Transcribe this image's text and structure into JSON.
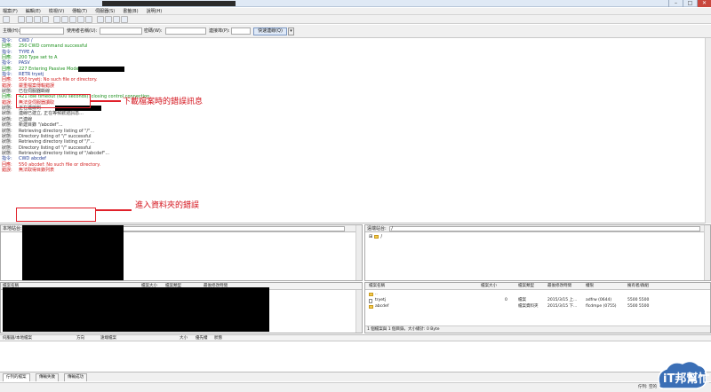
{
  "titlebar": {
    "controls": [
      "–",
      "□",
      "✕"
    ]
  },
  "menu": [
    "檔案(F)",
    "編輯(E)",
    "檢視(V)",
    "傳輸(T)",
    "伺服器(S)",
    "書籤(B)",
    "說明(H)"
  ],
  "quickconnect": {
    "host_label": "主機(H):",
    "user_label": "使用者名稱(U):",
    "pass_label": "密碼(W):",
    "port_label": "連接埠(P):",
    "button": "快速連線(Q)",
    "dropdown": "▾"
  },
  "log": [
    {
      "label": "指令:",
      "msg": "CWD /",
      "color": "blue"
    },
    {
      "label": "回應:",
      "msg": "250 CWD command successful",
      "color": "green"
    },
    {
      "label": "指令:",
      "msg": "TYPE A",
      "color": "blue"
    },
    {
      "label": "回應:",
      "msg": "200 Type set to A",
      "color": "green"
    },
    {
      "label": "指令:",
      "msg": "PASV",
      "color": "blue"
    },
    {
      "label": "回應:",
      "msg": "227 Entering Passive Mode",
      "color": "green",
      "redact": true
    },
    {
      "label": "指令:",
      "msg": "RETR tryetj",
      "color": "blue"
    },
    {
      "label": "回應:",
      "msg": "550 tryetj: No such file or directory.",
      "color": "red"
    },
    {
      "label": "錯誤:",
      "msg": "嚴重檔案傳輸錯誤",
      "color": "red"
    },
    {
      "label": "狀態:",
      "msg": "已在伺服器斷線",
      "color": "dark"
    },
    {
      "label": "回應:",
      "msg": "421 Idle timeout (600 seconds): closing control connection",
      "color": "green"
    },
    {
      "label": "錯誤:",
      "msg": "無法從伺服器讀取",
      "color": "red"
    },
    {
      "label": "狀態:",
      "msg": "正在連線到",
      "color": "dark",
      "redact": true
    },
    {
      "label": "狀態:",
      "msg": "連線已建立, 正在等候歡迎訊息...",
      "color": "dark"
    },
    {
      "label": "狀態:",
      "msg": "已連線",
      "color": "dark"
    },
    {
      "label": "狀態:",
      "msg": "新建目錄 \"/abcdef\"...",
      "color": "dark"
    },
    {
      "label": "狀態:",
      "msg": "Retrieving directory listing of \"/\"...",
      "color": "dark"
    },
    {
      "label": "狀態:",
      "msg": "Directory listing of \"/\" successful",
      "color": "dark"
    },
    {
      "label": "狀態:",
      "msg": "Retrieving directory listing of \"/\"...",
      "color": "dark"
    },
    {
      "label": "狀態:",
      "msg": "Directory listing of \"/\" successful",
      "color": "dark"
    },
    {
      "label": "狀態:",
      "msg": "Retrieving directory listing of \"/abcdef\"...",
      "color": "dark"
    },
    {
      "label": "指令:",
      "msg": "CWD abcdef",
      "color": "blue"
    },
    {
      "label": "回應:",
      "msg": "550 abcdef: No such file or directory.",
      "color": "red"
    },
    {
      "label": "錯誤:",
      "msg": "無法取得目錄列表",
      "color": "red"
    }
  ],
  "annotations": {
    "download_error": "下載檔案時的錯誤訊息",
    "enter_folder_error": "進入資料夾的錯誤"
  },
  "local": {
    "path_label": "本地站台:",
    "columns": [
      "檔案名稱",
      "檔案大小",
      "檔案類型",
      "最後修改時間"
    ]
  },
  "remote": {
    "path_label": "遠端站台:",
    "path_value": "/",
    "tree_root": "/",
    "columns": [
      "檔案名稱",
      "檔案大小",
      "檔案類型",
      "最後修改時間",
      "權限",
      "擁有者/群組"
    ],
    "files": [
      {
        "name": "..",
        "size": "",
        "type": "",
        "modified": "",
        "perm": "",
        "owner": "",
        "kind": "folder"
      },
      {
        "name": "tryetj",
        "size": "0",
        "type": "檔案",
        "modified": "2015/3/15 上...",
        "perm": "adfrw (0644)",
        "owner": "5500 5500",
        "kind": "file"
      },
      {
        "name": "abcdef",
        "size": "",
        "type": "檔案資料夾",
        "modified": "2015/3/15 下...",
        "perm": "flcdmpe (0755)",
        "owner": "5500 5500",
        "kind": "folder"
      }
    ],
    "status": "1 個檔案與 1 個目錄。大小總計: 0 Byte"
  },
  "queue": {
    "columns": [
      "伺服器/本地檔案",
      "方向",
      "遠端檔案",
      "大小",
      "優先權",
      "狀態"
    ]
  },
  "tabs": [
    "佇列的檔案",
    "傳輸失敗",
    "傳輸成功"
  ],
  "statusbar": {
    "queue": "佇列: 空的"
  },
  "logo": {
    "text": "iT邦幫忙"
  },
  "colors": {
    "green": "#1a8f1a",
    "blue": "#1f3a93",
    "red": "#d11b1b",
    "accent": "#e0202a"
  }
}
